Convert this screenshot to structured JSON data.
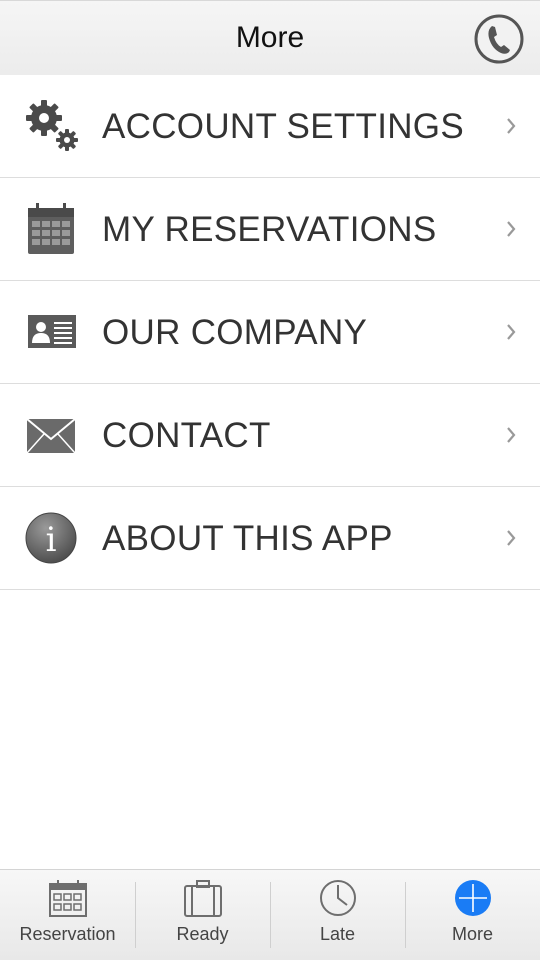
{
  "navbar": {
    "title": "More",
    "call_button_icon": "phone-icon"
  },
  "menu": {
    "items": [
      {
        "label": "ACCOUNT SETTINGS",
        "icon": "gears-icon"
      },
      {
        "label": "MY RESERVATIONS",
        "icon": "calendar-icon"
      },
      {
        "label": "OUR COMPANY",
        "icon": "id-card-icon"
      },
      {
        "label": "CONTACT",
        "icon": "envelope-icon"
      },
      {
        "label": "ABOUT THIS APP",
        "icon": "info-icon"
      }
    ]
  },
  "tabbar": {
    "tabs": [
      {
        "label": "Reservation",
        "icon": "calendar-icon",
        "selected": false
      },
      {
        "label": "Ready",
        "icon": "suitcase-icon",
        "selected": false
      },
      {
        "label": "Late",
        "icon": "clock-icon",
        "selected": false
      },
      {
        "label": "More",
        "icon": "plus-circle-icon",
        "selected": true
      }
    ]
  },
  "colors": {
    "selected_tab": "#1a7cf5",
    "icon_gray": "#6e6e6e",
    "text": "#333333"
  }
}
